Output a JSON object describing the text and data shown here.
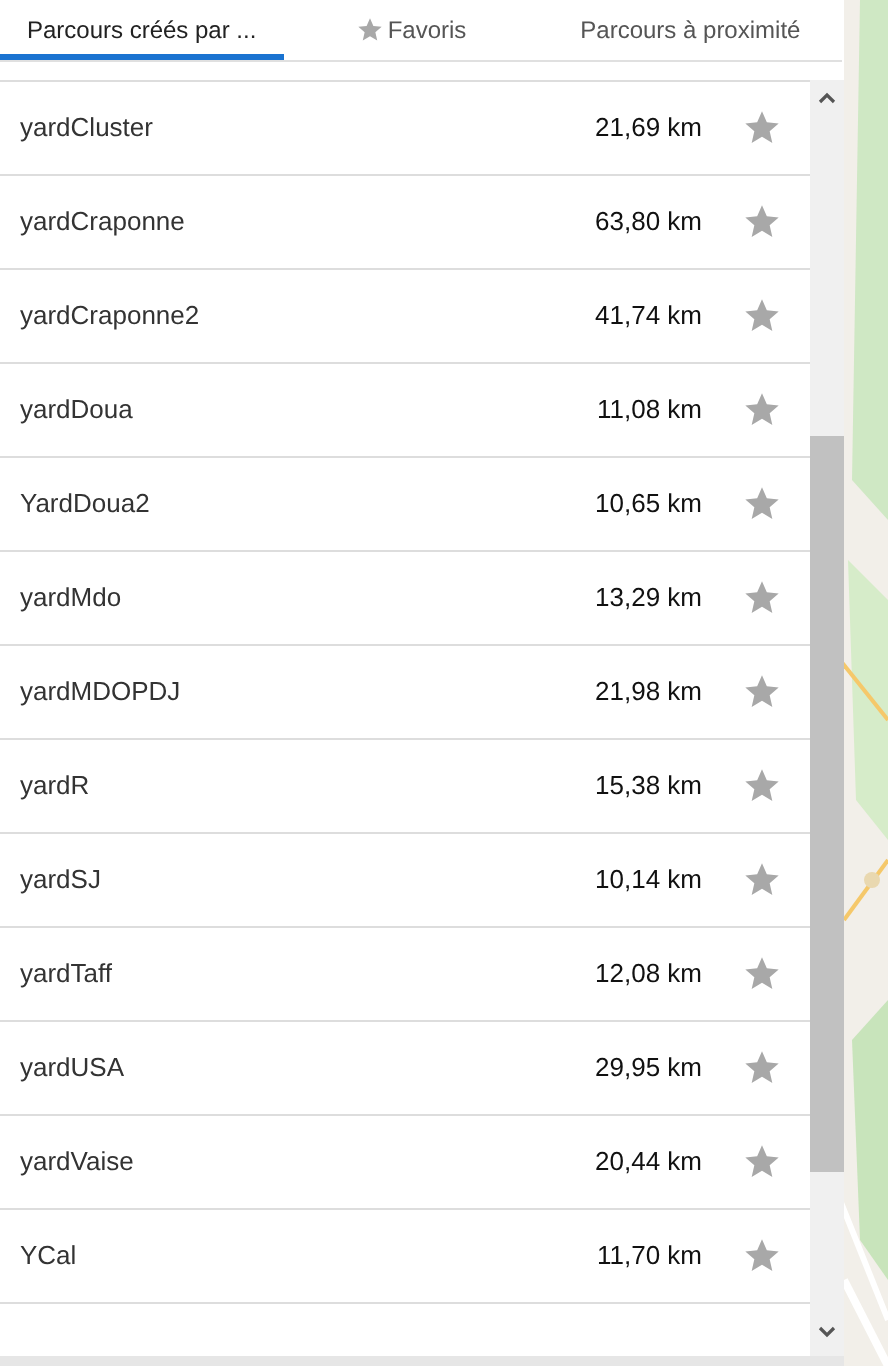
{
  "tabs": [
    {
      "label": "Parcours créés par ...",
      "icon": false,
      "selected": true
    },
    {
      "label": "Favoris",
      "icon": true,
      "selected": false
    },
    {
      "label": "Parcours à proximité",
      "icon": false,
      "selected": false
    }
  ],
  "routes": [
    {
      "name": "yardCluster",
      "distance": "21,69 km",
      "favorite": false
    },
    {
      "name": "yardCraponne",
      "distance": "63,80 km",
      "favorite": false
    },
    {
      "name": "yardCraponne2",
      "distance": "41,74 km",
      "favorite": false
    },
    {
      "name": "yardDoua",
      "distance": "11,08 km",
      "favorite": false
    },
    {
      "name": "YardDoua2",
      "distance": "10,65 km",
      "favorite": false
    },
    {
      "name": "yardMdo",
      "distance": "13,29 km",
      "favorite": false
    },
    {
      "name": "yardMDOPDJ",
      "distance": "21,98 km",
      "favorite": false
    },
    {
      "name": "yardR",
      "distance": "15,38 km",
      "favorite": false
    },
    {
      "name": "yardSJ",
      "distance": "10,14 km",
      "favorite": false
    },
    {
      "name": "yardTaff",
      "distance": "12,08 km",
      "favorite": false
    },
    {
      "name": "yardUSA",
      "distance": "29,95 km",
      "favorite": false
    },
    {
      "name": "yardVaise",
      "distance": "20,44 km",
      "favorite": false
    },
    {
      "name": "YCal",
      "distance": "11,70 km",
      "favorite": false
    }
  ]
}
